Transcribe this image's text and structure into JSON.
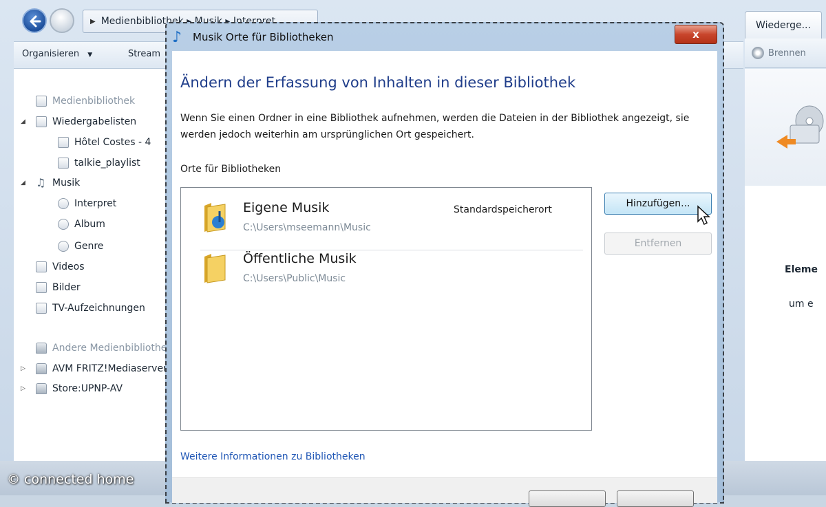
{
  "background": {
    "address": "Medienbibliothek ▸ Musik ▸ Interpret",
    "playback_tab": "Wiederge...",
    "toolbar": {
      "organize": "Organisieren",
      "stream": "Stream"
    },
    "right_toolbar": {
      "burn": "Brennen"
    },
    "nav_tree": [
      {
        "label": "Medienbibliothek",
        "icon": "library-icon",
        "dim": true
      },
      {
        "label": "Wiedergabelisten",
        "icon": "playlist-icon"
      },
      {
        "label": "Hôtel Costes - 4",
        "icon": "playlist-file-icon"
      },
      {
        "label": "talkie_playlist",
        "icon": "playlist-file-icon"
      },
      {
        "label": "Musik",
        "icon": "music-note-icon"
      },
      {
        "label": "Interpret",
        "icon": "artist-icon"
      },
      {
        "label": "Album",
        "icon": "album-icon"
      },
      {
        "label": "Genre",
        "icon": "genre-icon"
      },
      {
        "label": "Videos",
        "icon": "video-icon"
      },
      {
        "label": "Bilder",
        "icon": "picture-icon"
      },
      {
        "label": "TV-Aufzeichnungen",
        "icon": "tv-icon"
      },
      {
        "label": "Andere Medienbibliotheken",
        "icon": "other-libraries-icon",
        "dim": true
      },
      {
        "label": "AVM FRITZ!Mediaserver",
        "icon": "media-server-icon"
      },
      {
        "label": "Store:UPNP-AV",
        "icon": "media-server-icon"
      }
    ],
    "right_pane": {
      "heading": "Eleme",
      "text": "um e"
    },
    "watermark": "© connected home"
  },
  "dialog": {
    "title": "Musik Orte für Bibliotheken",
    "close_label": "x",
    "heading": "Ändern der Erfassung von Inhalten in dieser Bibliothek",
    "description": "Wenn Sie einen Ordner in eine Bibliothek aufnehmen, werden die Dateien in der Bibliothek angezeigt, sie werden jedoch weiterhin am ursprünglichen Ort gespeichert.",
    "section_label": "Orte für Bibliotheken",
    "locations": [
      {
        "name": "Eigene Musik",
        "path": "C:\\Users\\mseemann\\Music",
        "badge": "Standardspeicherort",
        "icon": "music-folder-icon"
      },
      {
        "name": "Öffentliche Musik",
        "path": "C:\\Users\\Public\\Music",
        "badge": "",
        "icon": "folder-icon"
      }
    ],
    "add_button": "Hinzufügen...",
    "remove_button": "Entfernen",
    "more_info_link": "Weitere Informationen zu Bibliotheken"
  }
}
